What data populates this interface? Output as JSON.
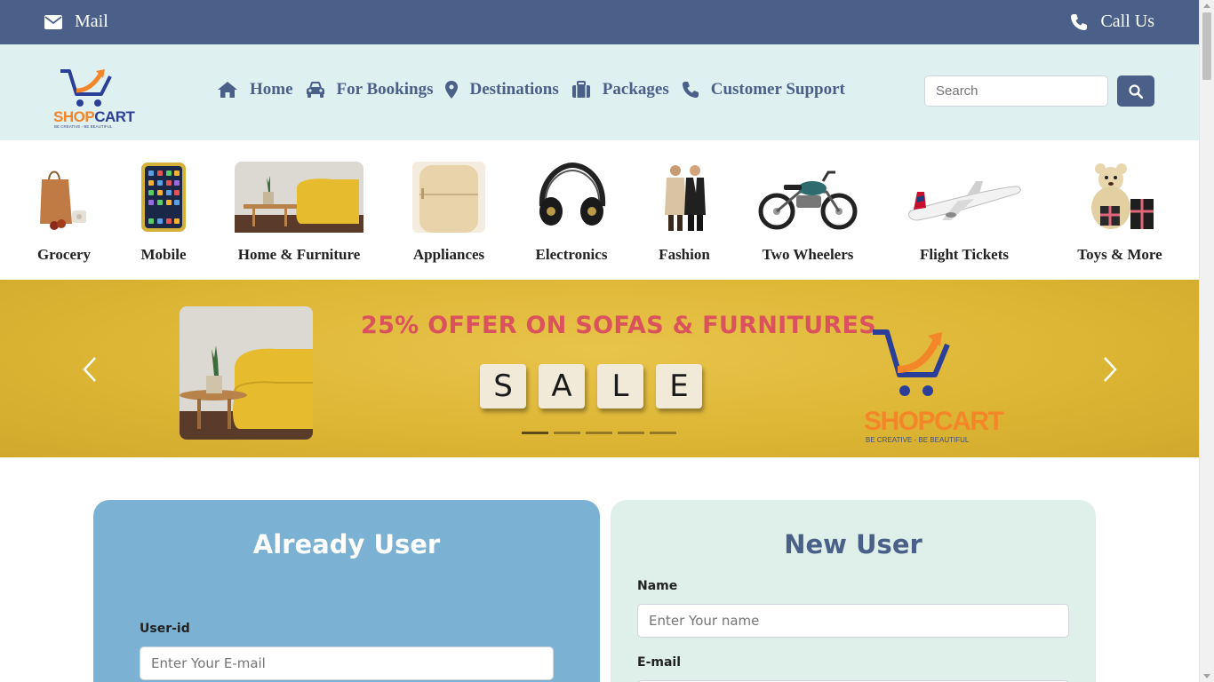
{
  "topbar": {
    "mail_label": "Mail",
    "call_label": "Call Us",
    "bg": "#4a6089"
  },
  "logo": {
    "brand": "SHOPCART",
    "tagline": "BE CREATIVE - BE BEAUTIFUL",
    "orange": "#f4862a",
    "blue": "#2b3f99"
  },
  "nav": {
    "items": [
      {
        "label": "Home",
        "icon": "home-icon"
      },
      {
        "label": "For Bookings",
        "icon": "car-icon"
      },
      {
        "label": "Destinations",
        "icon": "map-marker-icon"
      },
      {
        "label": "Packages",
        "icon": "suitcase-icon"
      },
      {
        "label": "Customer Support",
        "icon": "phone-icon"
      }
    ],
    "search_placeholder": "Search"
  },
  "categories": [
    {
      "label": "Grocery"
    },
    {
      "label": "Mobile"
    },
    {
      "label": "Home & Furniture"
    },
    {
      "label": "Appliances"
    },
    {
      "label": "Electronics"
    },
    {
      "label": "Fashion"
    },
    {
      "label": "Two Wheelers"
    },
    {
      "label": "Flight Tickets"
    },
    {
      "label": "Toys & More"
    }
  ],
  "banner": {
    "offer_text": "25% OFFER ON SOFAS & FURNITURES",
    "tiles": [
      "S",
      "A",
      "L",
      "E"
    ],
    "slide_count": 5,
    "active_slide": 1,
    "brand": "SHOPCART",
    "tagline": "BE CREATIVE - BE BEAUTIFUL"
  },
  "login": {
    "title": "Already User",
    "userid_label": "User-id",
    "userid_placeholder": "Enter Your E-mail"
  },
  "signup": {
    "title": "New User",
    "name_label": "Name",
    "name_placeholder": "Enter Your name",
    "email_label": "E-mail"
  }
}
